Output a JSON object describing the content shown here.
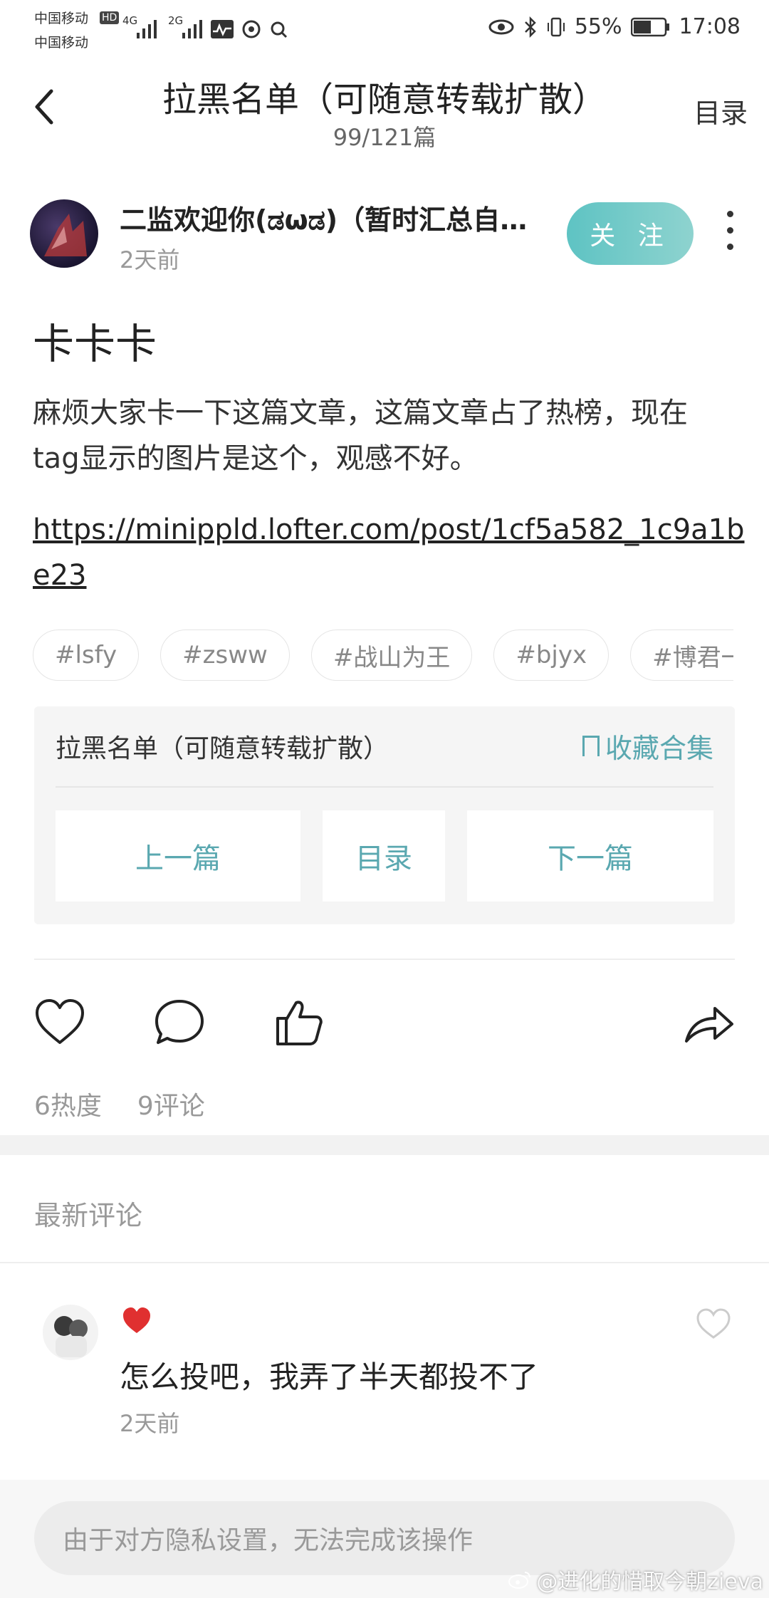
{
  "status_bar": {
    "carrier1": "中国移动",
    "carrier2": "中国移动",
    "hd_badge": "HD",
    "net1": "4G",
    "net2": "2G",
    "battery": "55%",
    "time": "17:08"
  },
  "header": {
    "title": "拉黑名单（可随意转载扩散）",
    "subtitle": "99/121篇",
    "menu_label": "目录"
  },
  "author": {
    "name": "二监欢迎你(ಡωಡ)（暂时汇总自助站）",
    "time": "2天前",
    "follow_label": "关 注"
  },
  "post": {
    "title": "卡卡卡",
    "body": "麻烦大家卡一下这篇文章，这篇文章占了热榜，现在tag显示的图片是这个，观感不好。",
    "link": "https://minippld.lofter.com/post/1cf5a582_1c9a1be23"
  },
  "tags": [
    "#lsfy",
    "#zsww",
    "#战山为王",
    "#bjyx",
    "#博君一肖"
  ],
  "collection": {
    "title": "拉黑名单（可随意转载扩散）",
    "favorite_label": "收藏合集",
    "prev_label": "上一篇",
    "toc_label": "目录",
    "next_label": "下一篇"
  },
  "stats": {
    "heat": "6热度",
    "comments": "9评论"
  },
  "latest_comments_label": "最新评论",
  "comments": [
    {
      "text": "怎么投吧，我弄了半天都投不了",
      "time": "2天前"
    }
  ],
  "input_placeholder": "由于对方隐私设置，无法完成该操作",
  "watermark": "@进化的惜取今朝zieva",
  "colors": {
    "accent": "#5aa8b0",
    "follow_gradient_start": "#5ec3c3",
    "follow_gradient_end": "#8ed3cf",
    "heart_badge": "#e03030"
  },
  "icons": [
    "back-icon",
    "more-icon",
    "like-icon",
    "comment-icon",
    "thumbs-up-icon",
    "share-icon",
    "bookmark-icon",
    "heart-badge-icon",
    "comment-like-icon",
    "weibo-icon"
  ]
}
